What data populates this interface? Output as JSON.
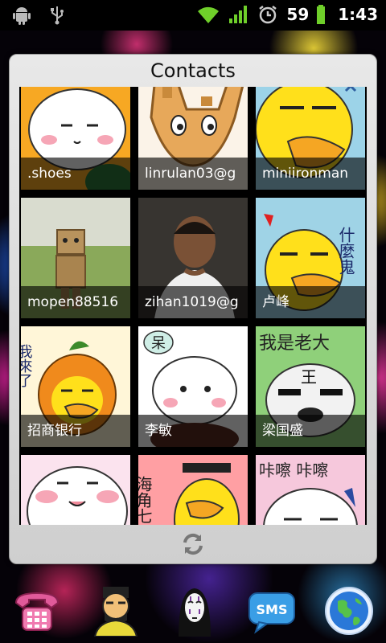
{
  "status_bar": {
    "left_icons": [
      "android-debug-icon",
      "usb-icon"
    ],
    "right_icons": [
      "wifi-icon",
      "signal-icon",
      "alarm-icon",
      "battery-icon"
    ],
    "battery_level": "59",
    "time": "1:43"
  },
  "widget": {
    "title": "Contacts",
    "refresh_icon": "refresh-icon",
    "contacts": [
      {
        "name": ".shoes"
      },
      {
        "name": "linrulan03@g"
      },
      {
        "name": "miniironman"
      },
      {
        "name": "mopen88516"
      },
      {
        "name": "zihan1019@g"
      },
      {
        "name": "卢峰"
      },
      {
        "name": "招商银行"
      },
      {
        "name": "李敏"
      },
      {
        "name": "梁国盛"
      },
      {
        "name": ""
      },
      {
        "name": ""
      },
      {
        "name": ""
      }
    ],
    "art_text": {
      "tile6": "什麼鬼",
      "tile7": "我來了",
      "tile8": "呆",
      "tile9": "我是老大",
      "tile9b": "王",
      "tile11": "海角七",
      "tile12": "咔嚓 咔嚓"
    }
  },
  "dock": {
    "icons": [
      "phone-icon",
      "contacts-icon",
      "noface-app-icon",
      "sms-icon",
      "browser-icon"
    ],
    "sms_label": "SMS"
  }
}
